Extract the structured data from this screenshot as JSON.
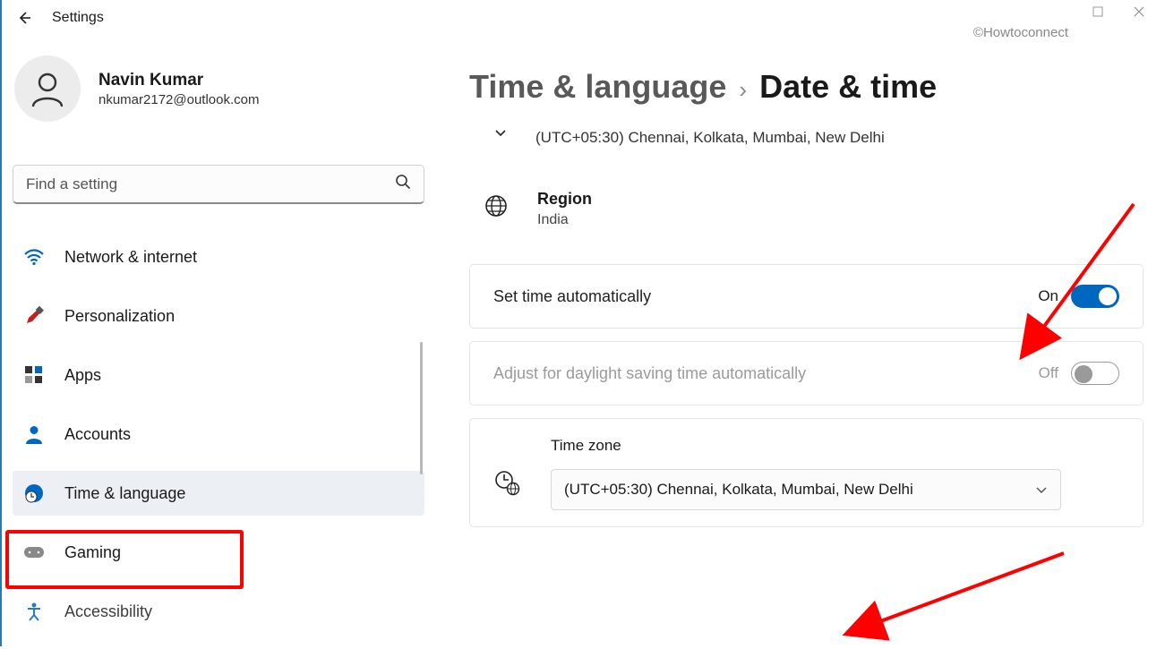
{
  "app": {
    "title": "Settings",
    "watermark": "©Howtoconnect"
  },
  "user": {
    "name": "Navin Kumar",
    "email": "nkumar2172@outlook.com"
  },
  "search": {
    "placeholder": "Find a setting"
  },
  "sidebar": {
    "items": [
      {
        "label": "Network & internet"
      },
      {
        "label": "Personalization"
      },
      {
        "label": "Apps"
      },
      {
        "label": "Accounts"
      },
      {
        "label": "Time & language"
      },
      {
        "label": "Gaming"
      },
      {
        "label": "Accessibility"
      }
    ]
  },
  "breadcrumb": {
    "parent": "Time & language",
    "current": "Date & time"
  },
  "timezone_subline": "(UTC+05:30) Chennai, Kolkata, Mumbai, New Delhi",
  "region": {
    "title": "Region",
    "value": "India"
  },
  "settings": {
    "auto_time": {
      "label": "Set time automatically",
      "state": "On"
    },
    "dst": {
      "label": "Adjust for daylight saving time automatically",
      "state": "Off"
    },
    "timezone": {
      "label": "Time zone",
      "value": "(UTC+05:30) Chennai, Kolkata, Mumbai, New Delhi"
    }
  }
}
